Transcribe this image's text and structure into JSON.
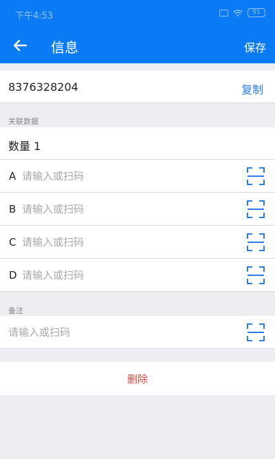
{
  "status_bar": {
    "time": "下午4:53",
    "battery": "91"
  },
  "header": {
    "title": "信息",
    "save_label": "保存"
  },
  "record": {
    "code": "8376328204",
    "copy_label": "复制"
  },
  "associated": {
    "section_label": "关联数据",
    "quantity_text": "数量  1",
    "fields": [
      {
        "label": "A",
        "placeholder": "请输入或扫码"
      },
      {
        "label": "B",
        "placeholder": "请输入或扫码"
      },
      {
        "label": "C",
        "placeholder": "请输入或扫码"
      },
      {
        "label": "D",
        "placeholder": "请输入或扫码"
      }
    ]
  },
  "remarks": {
    "section_label": "备注",
    "placeholder": "请输入或扫码"
  },
  "actions": {
    "delete_label": "删除"
  },
  "colors": {
    "primary": "#0a7bf5",
    "link": "#2a7de8",
    "danger": "#e8453c",
    "background": "#eeeef2"
  }
}
